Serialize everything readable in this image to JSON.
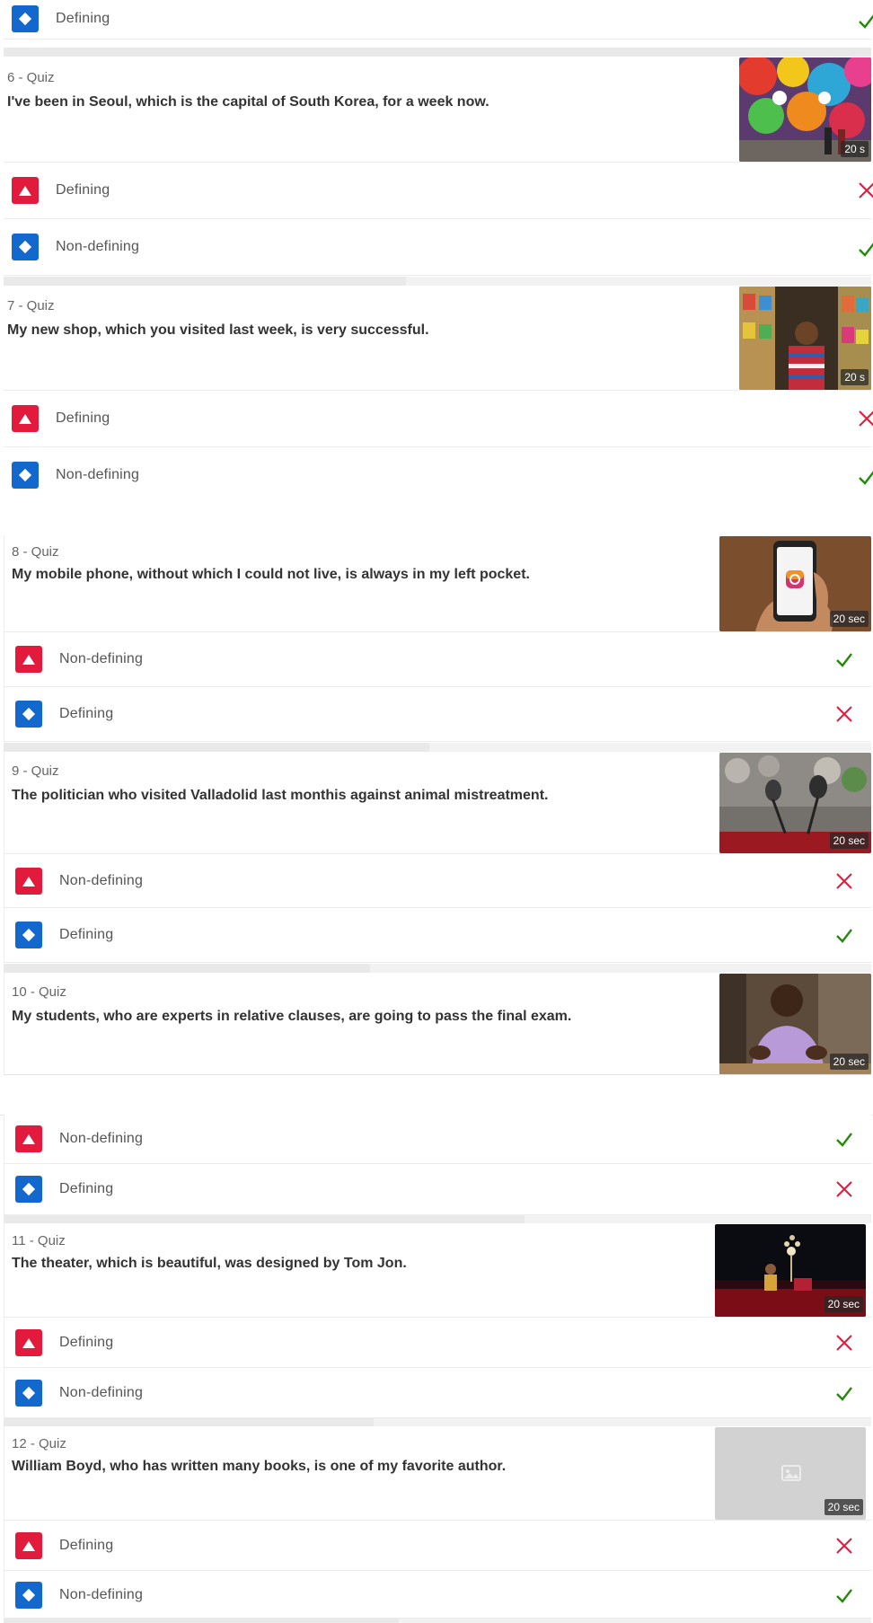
{
  "colors": {
    "red": "#e21b3c",
    "blue": "#1368ce",
    "correct": "#26890c",
    "wrong": "#e21b3c"
  },
  "questions": [
    {
      "header": "",
      "text": "",
      "answers": [
        {
          "shape": "diamond-icon",
          "label": "Defining",
          "result": "correct"
        }
      ]
    },
    {
      "header": "6 - Quiz",
      "text": "I've been in Seoul, which is the capital of South Korea, for a week now.",
      "time": "20 s",
      "image": "graffiti-wall-image",
      "answers": [
        {
          "shape": "triangle-icon",
          "label": "Defining",
          "result": "wrong"
        },
        {
          "shape": "diamond-icon",
          "label": "Non-defining",
          "result": "correct"
        }
      ]
    },
    {
      "header": "7 - Quiz",
      "text": "My new shop, which you visited last week, is very successful.",
      "time": "20 s",
      "image": "shopkeeper-image",
      "answers": [
        {
          "shape": "triangle-icon",
          "label": "Defining",
          "result": "wrong"
        },
        {
          "shape": "diamond-icon",
          "label": "Non-defining",
          "result": "correct"
        }
      ]
    },
    {
      "header": "8 - Quiz",
      "text": "My mobile phone, without which I could not live, is always in my left pocket.",
      "time": "20 sec",
      "image": "phone-instagram-image",
      "answers": [
        {
          "shape": "triangle-icon",
          "label": "Non-defining",
          "result": "correct"
        },
        {
          "shape": "diamond-icon",
          "label": "Defining",
          "result": "wrong"
        }
      ]
    },
    {
      "header": "9 - Quiz",
      "text": "The politician who visited Valladolid last monthis against animal mistreatment.",
      "time": "20 sec",
      "image": "microphones-image",
      "answers": [
        {
          "shape": "triangle-icon",
          "label": "Non-defining",
          "result": "wrong"
        },
        {
          "shape": "diamond-icon",
          "label": "Defining",
          "result": "correct"
        }
      ]
    },
    {
      "header": "10 - Quiz",
      "text": "My students, who are experts in relative clauses, are going to pass the final exam.",
      "time": "20 sec",
      "image": "student-image",
      "answers": [
        {
          "shape": "triangle-icon",
          "label": "Non-defining",
          "result": "correct"
        },
        {
          "shape": "diamond-icon",
          "label": "Defining",
          "result": "wrong"
        }
      ]
    },
    {
      "header": "11 - Quiz",
      "text": "The theater, which is beautiful, was designed by Tom Jon.",
      "time": "20 sec",
      "image": "theater-stage-image",
      "answers": [
        {
          "shape": "triangle-icon",
          "label": "Defining",
          "result": "wrong"
        },
        {
          "shape": "diamond-icon",
          "label": "Non-defining",
          "result": "correct"
        }
      ]
    },
    {
      "header": "12 - Quiz",
      "text": "William Boyd, who has written many books, is one of my favorite author.",
      "time": "20 sec",
      "image": "image-placeholder-icon",
      "answers": [
        {
          "shape": "triangle-icon",
          "label": "Defining",
          "result": "wrong"
        },
        {
          "shape": "diamond-icon",
          "label": "Non-defining",
          "result": "correct"
        }
      ]
    }
  ]
}
